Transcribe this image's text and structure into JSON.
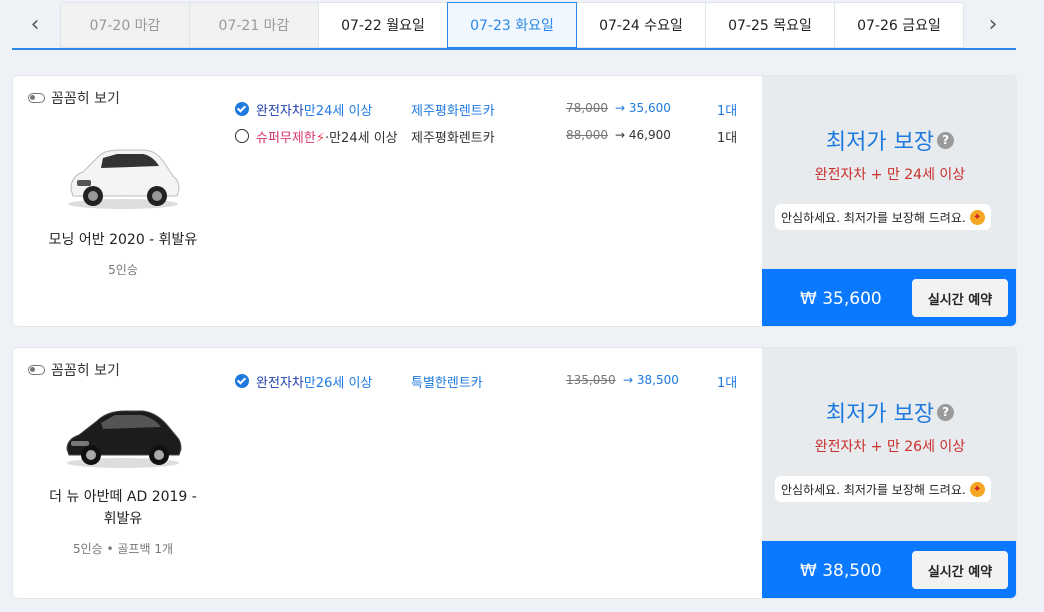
{
  "date_nav": {
    "prev_icon": "‹",
    "next_icon": "›",
    "tabs": [
      {
        "label": "07-20 마감",
        "state": "closed"
      },
      {
        "label": "07-21 마감",
        "state": "closed"
      },
      {
        "label": "07-22 월요일",
        "state": "normal"
      },
      {
        "label": "07-23 화요일",
        "state": "active"
      },
      {
        "label": "07-24 수요일",
        "state": "normal"
      },
      {
        "label": "07-25 목요일",
        "state": "normal"
      },
      {
        "label": "07-26 금요일",
        "state": "normal"
      }
    ]
  },
  "cars": [
    {
      "detail_label": "꼼꼼히 보기",
      "name": "모닝 어반 2020 - 휘발유",
      "spec": "5인승",
      "car_color": "white",
      "options": [
        {
          "checked": true,
          "insurance": "완전자차",
          "bolt": "",
          "age": "만24세 이상",
          "company": "제주평화렌트카",
          "old_price": "78,000",
          "arrow": "→",
          "new_price": "35,600",
          "count": "1대"
        },
        {
          "checked": false,
          "insurance": "슈퍼무제한",
          "bolt": "⚡",
          "age": "만24세 이상",
          "company": "제주평화렌트카",
          "old_price": "88,000",
          "arrow": "→",
          "new_price": "46,900",
          "count": "1대"
        }
      ],
      "guarantee": {
        "title": "최저가 보장",
        "help_icon": "?",
        "subtitle": "완전자차 + 만 24세 이상",
        "reassure": "안심하세요. 최저가를 보장해 드려요."
      },
      "final_price": "₩ 35,600",
      "book_label": "실시간 예약"
    },
    {
      "detail_label": "꼼꼼히 보기",
      "name": "더 뉴 아반떼 AD 2019 - 휘발유",
      "spec": "5인승 • 골프백 1개",
      "car_color": "black",
      "options": [
        {
          "checked": true,
          "insurance": "완전자차",
          "bolt": "",
          "age": "만26세 이상",
          "company": "특별한렌트카",
          "old_price": "135,050",
          "arrow": "→",
          "new_price": "38,500",
          "count": "1대"
        }
      ],
      "guarantee": {
        "title": "최저가 보장",
        "help_icon": "?",
        "subtitle": "완전자차 + 만 26세 이상",
        "reassure": "안심하세요. 최저가를 보장해 드려요."
      },
      "final_price": "₩ 38,500",
      "book_label": "실시간 예약"
    }
  ]
}
